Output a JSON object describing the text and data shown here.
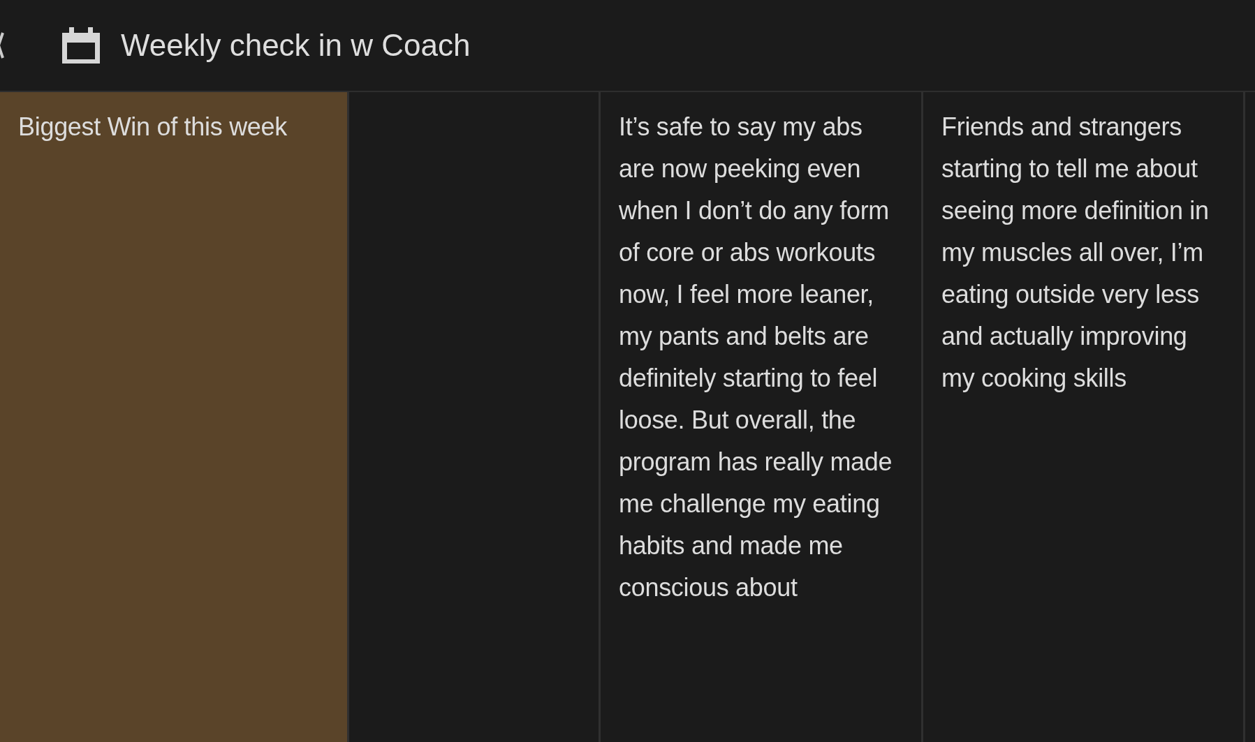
{
  "header": {
    "title": "Weekly check in w Coach"
  },
  "columns": [
    {
      "kind": "label",
      "text": "Biggest Win of this week"
    },
    {
      "kind": "empty"
    },
    {
      "kind": "answer",
      "text": "It’s safe to say my abs are now peeking even when I don’t do any form of core or abs workouts now, I feel more leaner, my pants and belts are definitely starting to feel loose. But overall, the program has really made me challenge my eating habits and made me conscious about"
    },
    {
      "kind": "answer",
      "text": "Friends and strangers starting to tell me about seeing more definition in my muscles all over, I’m eating outside very less and actually improving my cooking skills"
    }
  ]
}
